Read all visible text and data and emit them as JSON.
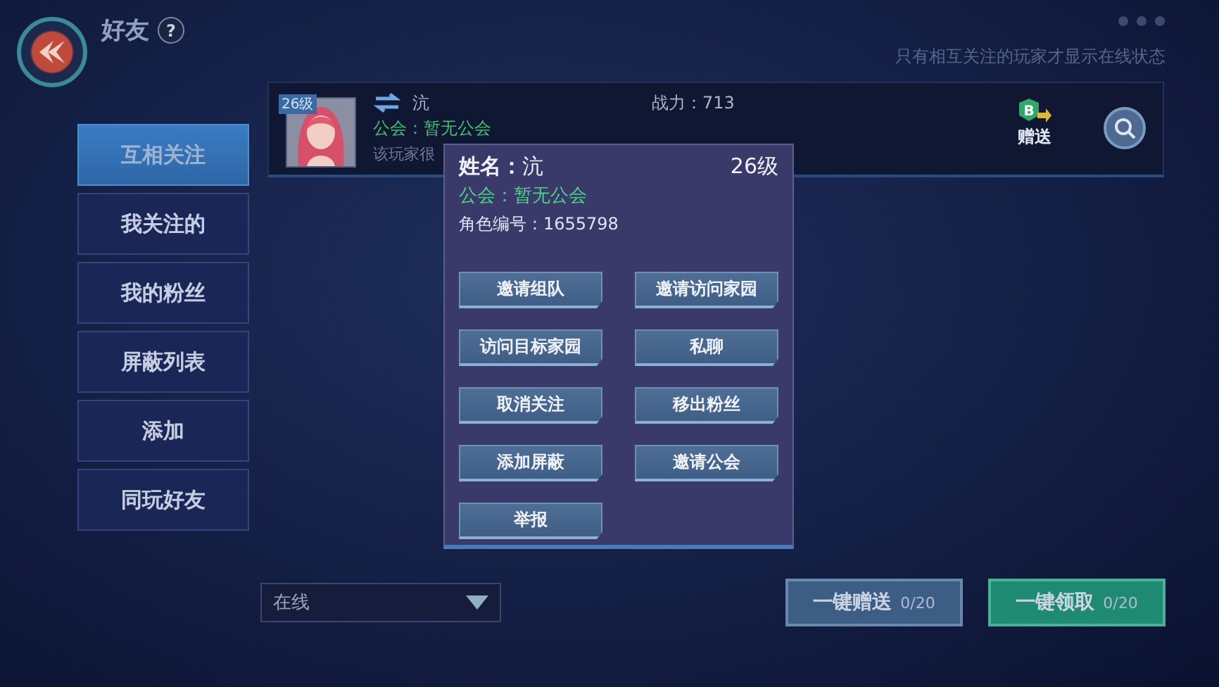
{
  "header": {
    "title": "好友",
    "help": "?",
    "hint": "只有相互关注的玩家才显示在线状态"
  },
  "tabs": [
    {
      "label": "互相关注",
      "selected": true
    },
    {
      "label": "我关注的",
      "selected": false
    },
    {
      "label": "我的粉丝",
      "selected": false
    },
    {
      "label": "屏蔽列表",
      "selected": false
    },
    {
      "label": "添加",
      "selected": false
    },
    {
      "label": "同玩好友",
      "selected": false
    }
  ],
  "friend": {
    "level": "26级",
    "name": "沆",
    "power": "战力：713",
    "guild": "公会：暂无公会",
    "signature": "该玩家很",
    "gift_badge": "B",
    "gift": "赠送"
  },
  "popup": {
    "name": "**姓名：**沆",
    "level": "26级",
    "guild": "公会：暂无公会",
    "role_id": "角色编号：1655798",
    "actions": [
      "邀请组队",
      "邀请访问家园",
      "访问目标家园",
      "私聊",
      "取消关注",
      "移出粉丝",
      "添加屏蔽",
      "邀请公会",
      "举报"
    ]
  },
  "filter": {
    "value": "在线"
  },
  "buttons": [
    {
      "label": "一键赠送",
      "count": "0/20",
      "kind": "send"
    },
    {
      "label": "一键领取",
      "count": "0/20",
      "kind": "claim"
    }
  ]
}
